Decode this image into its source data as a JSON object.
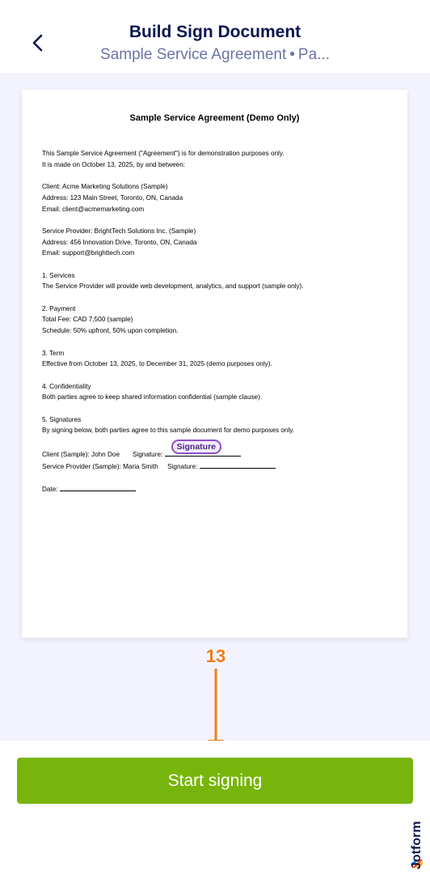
{
  "header": {
    "title": "Build Sign Document",
    "subtitle_name": "Sample Service Agreement",
    "subtitle_sep": "•",
    "subtitle_rest": "Pa..."
  },
  "document": {
    "title": "Sample Service Agreement (Demo Only)",
    "intro_1": "This Sample Service Agreement (\"Agreement\") is for demonstration purposes only.",
    "intro_2": "It is made on October 13, 2025, by and between:",
    "client_1": "Client: Acme Marketing Solutions (Sample)",
    "client_2": "Address: 123 Main Street, Toronto, ON, Canada",
    "client_3": "Email: client@acmemarketing.com",
    "provider_1": "Service Provider: BrightTech Solutions Inc. (Sample)",
    "provider_2": "Address: 456 Innovation Drive, Toronto, ON, Canada",
    "provider_3": "Email: support@brighttech.com",
    "s1_title": "1. Services",
    "s1_text": "The Service Provider will provide web development, analytics, and support (sample only).",
    "s2_title": "2. Payment",
    "s2_text_1": "Total Fee: CAD 7,500 (sample)",
    "s2_text_2": "Schedule: 50% upfront, 50% upon completion.",
    "s3_title": "3. Term",
    "s3_text": "Effective from October 13, 2025, to December 31, 2025 (demo purposes only).",
    "s4_title": "4. Confidentiality",
    "s4_text": "Both parties agree to keep shared information confidential (sample clause).",
    "s5_title": "5. Signatures",
    "s5_text": "By signing below, both parties agree to this sample document for demo purposes only.",
    "client_sig_label": "Client (Sample): John Doe",
    "signature_word": "Signature:",
    "signature_badge": "Signature",
    "provider_sig_label": "Service Provider (Sample): Maria Smith",
    "date_label": "Date:"
  },
  "annotation": {
    "step_number": "13",
    "color": "#f07c1a"
  },
  "footer": {
    "start_button": "Start signing",
    "button_color": "#78b50c"
  },
  "brand": {
    "name": "Jotform"
  }
}
